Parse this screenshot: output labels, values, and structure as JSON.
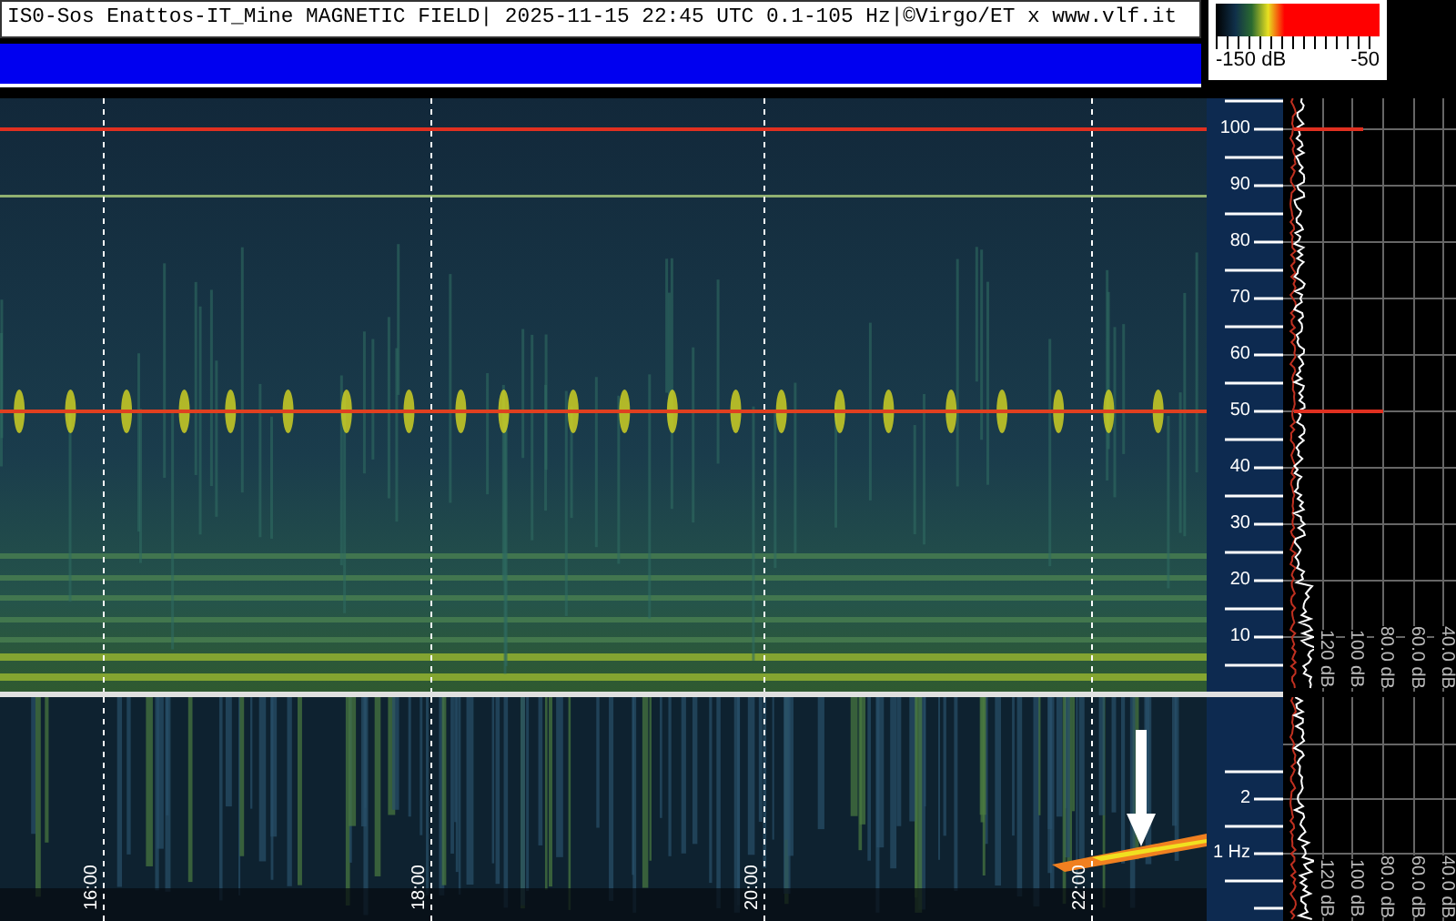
{
  "header": {
    "title": "IS0-Sos Enattos-IT_Mine MAGNETIC FIELD| 2025-11-15 22:45 UTC 0.1-105 Hz|©Virgo/ET x www.vlf.it"
  },
  "color_scale": {
    "min_label": "-150 dB",
    "max_label": "-50"
  },
  "upper_panel": {
    "frequency_labels": [
      "100",
      "90",
      "80",
      "70",
      "60",
      "50",
      "40",
      "30",
      "20",
      "10"
    ],
    "spectrum_labels": [
      "120 dB",
      "100 dB",
      "80.0 dB",
      "60.0 dB",
      "40.0 dB"
    ]
  },
  "lower_panel": {
    "frequency_labels": [
      "2",
      "1 Hz"
    ],
    "time_labels": [
      "16:00",
      "18:00",
      "20:00",
      "22:00"
    ],
    "spectrum_labels": [
      "120 dB",
      "100 dB",
      "80.0 dB",
      "60.0 dB",
      "40.0 dB"
    ]
  }
}
